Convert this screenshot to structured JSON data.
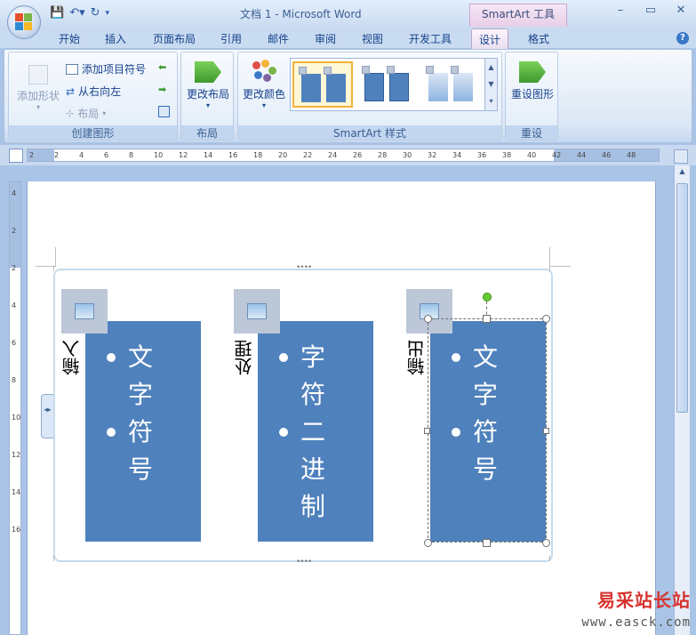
{
  "window": {
    "title": "文档 1 - Microsoft Word",
    "context_tab_title": "SmartArt 工具",
    "controls": [
      "–",
      "▭",
      "✕"
    ]
  },
  "tabs": [
    "开始",
    "插入",
    "页面布局",
    "引用",
    "邮件",
    "审阅",
    "视图",
    "开发工具",
    "设计",
    "格式"
  ],
  "active_tab": "设计",
  "ribbon": {
    "create_group": {
      "label": "创建图形",
      "add_shape": "添加形状",
      "add_bullet": "添加项目符号",
      "right_to_left": "从右向左",
      "layout": "布局"
    },
    "layout_group": {
      "label": "布局",
      "change_layout": "更改布局"
    },
    "styles_group": {
      "label": "SmartArt 样式",
      "change_colors": "更改颜色"
    },
    "reset_group": {
      "label": "重设",
      "reset_graphic": "重设图形"
    }
  },
  "ruler": {
    "numbers": [
      "2",
      "2",
      "4",
      "6",
      "8",
      "10",
      "12",
      "14",
      "16",
      "18",
      "20",
      "22",
      "24",
      "26",
      "28",
      "30",
      "32",
      "34",
      "36",
      "38",
      "40",
      "42",
      "44",
      "46",
      "48"
    ]
  },
  "vruler": {
    "numbers": [
      "4",
      "2",
      "2",
      "4",
      "6",
      "8",
      "10",
      "12",
      "14",
      "16"
    ]
  },
  "smartart": {
    "items": [
      {
        "label": "输入",
        "bullets": [
          "文字",
          "符号"
        ]
      },
      {
        "label": "处理",
        "bullets": [
          "字符",
          "二进制"
        ]
      },
      {
        "label": "输出",
        "bullets": [
          "文字",
          "符号"
        ]
      }
    ],
    "selected_index": 2,
    "box_color": "#4f81bd",
    "picture_placeholder_color": "#bcc7d8"
  },
  "watermark": {
    "text": "易采站长站",
    "url": "www.easck.com"
  },
  "colors": {
    "accent": "#4f81bd",
    "ribbon_text": "#15428b"
  }
}
